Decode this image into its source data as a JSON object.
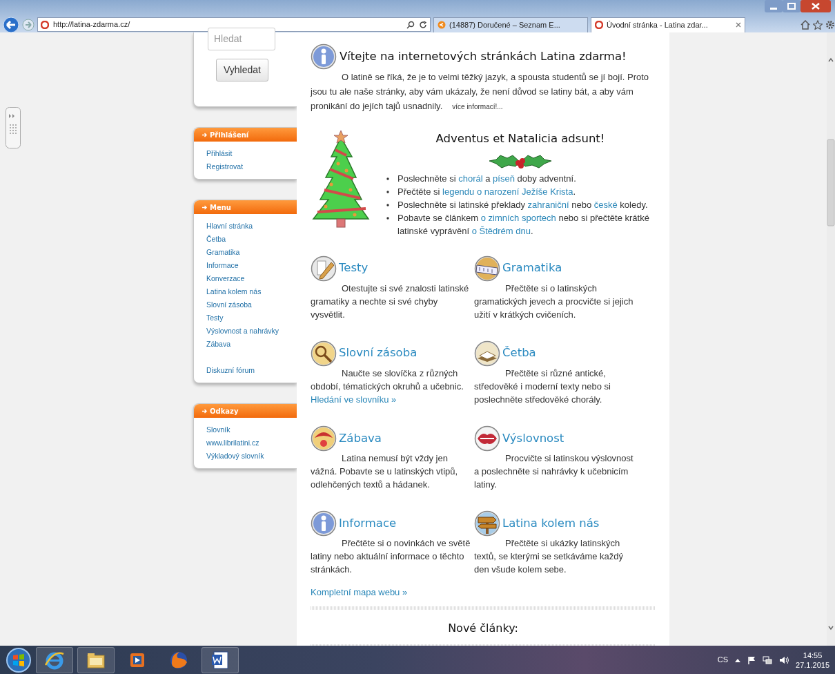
{
  "browser": {
    "url": "http://latina-zdarma.cz/",
    "tabs": [
      {
        "title": "(14887) Doručené – Seznam E...",
        "selected": false
      },
      {
        "title": "Úvodní stránka - Latina zdar...",
        "selected": true
      }
    ]
  },
  "sidebar": {
    "search": {
      "placeholder": "Hledat",
      "button": "Vyhledat"
    },
    "panels": [
      {
        "title": "Přihlášení",
        "groups": [
          [
            "Přihlásit",
            "Registrovat"
          ]
        ]
      },
      {
        "title": "Menu",
        "groups": [
          [
            "Hlavní stránka",
            "Četba",
            "Gramatika",
            "Informace",
            "Konverzace",
            "Latina kolem nás",
            "Slovní zásoba",
            "Testy",
            "Výslovnost a nahrávky",
            "Zábava"
          ],
          [
            "Diskuzní fórum"
          ]
        ]
      },
      {
        "title": "Odkazy",
        "groups": [
          [
            "Slovník",
            "www.librilatini.cz",
            "Výkladový slovník"
          ]
        ]
      }
    ]
  },
  "welcome": {
    "title": "Vítejte na internetových stránkách Latina zdarma!",
    "text": "O latině se říká, že je to velmi těžký jazyk, a spousta studentů se jí bojí. Proto jsou tu ale naše stránky, aby vám ukázaly, že není důvod se latiny bát, a aby vám pronikání do jejích tajů usnadnily.",
    "more_link": "více informací!..."
  },
  "advent": {
    "title": "Adventus et Natalicia adsunt!",
    "items": [
      [
        {
          "kind": "text",
          "text": "Poslechněte si "
        },
        {
          "kind": "link",
          "text": "chorál"
        },
        {
          "kind": "text",
          "text": " a "
        },
        {
          "kind": "link",
          "text": "píseň"
        },
        {
          "kind": "text",
          "text": " doby adventní."
        }
      ],
      [
        {
          "kind": "text",
          "text": "Přečtěte si "
        },
        {
          "kind": "link",
          "text": "legendu o narození Ježíše Krista"
        },
        {
          "kind": "text",
          "text": "."
        }
      ],
      [
        {
          "kind": "text",
          "text": "Poslechněte si latinské překlady "
        },
        {
          "kind": "link",
          "text": "zahraniční"
        },
        {
          "kind": "text",
          "text": " nebo "
        },
        {
          "kind": "link",
          "text": "české"
        },
        {
          "kind": "text",
          "text": " koledy."
        }
      ],
      [
        {
          "kind": "text",
          "text": "Pobavte se článkem "
        },
        {
          "kind": "link",
          "text": "o zimních sportech"
        },
        {
          "kind": "text",
          "text": " nebo si přečtěte krátké latinské vyprávění "
        },
        {
          "kind": "link",
          "text": "o Štědrém dnu"
        },
        {
          "kind": "text",
          "text": "."
        }
      ]
    ]
  },
  "sections": [
    {
      "title": "Testy",
      "text": "Otestujte si své znalosti latinské gramatiky a nechte si své chyby vysvětlit."
    },
    {
      "title": "Gramatika",
      "text": "Přečtěte si o latinských gramatických jevech a procvičte si jejich užití v krátkých cvičeních."
    },
    {
      "title": "Slovní zásoba",
      "text": "Naučte se slovíčka z různých období, tématických okruhů a učebnic.",
      "link": "Hledání ve slovníku »"
    },
    {
      "title": "Četba",
      "text": "Přečtěte si různé antické, středověké i moderní texty nebo si poslechněte středověké chorály."
    },
    {
      "title": "Zábava",
      "text": "Latina nemusí být vždy jen vážná. Pobavte se u latinských vtipů, odlehčených textů a hádanek."
    },
    {
      "title": "Výslovnost",
      "text": "Procvičte si latinskou výslovnost a poslechněte si nahrávky k učebnicím latiny."
    },
    {
      "title": "Informace",
      "text": "Přečtěte si o novinkách ve světě latiny nebo aktuální informace o těchto stránkách."
    },
    {
      "title": "Latina kolem nás",
      "text": "Přečtěte si ukázky latinských textů, se kterými se setkáváme každý den všude kolem sebe."
    }
  ],
  "sitemap_link": "Kompletní mapa webu »",
  "new_articles_title": "Nové články:",
  "taskbar": {
    "language": "CS",
    "time": "14:55",
    "date": "27.1.2015"
  }
}
